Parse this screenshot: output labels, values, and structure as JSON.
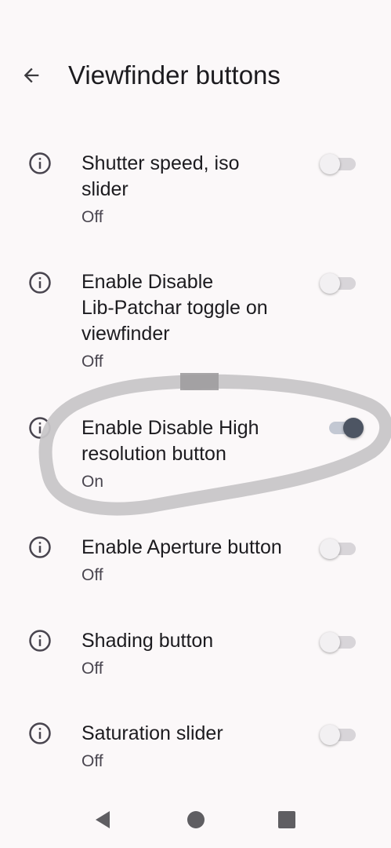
{
  "header": {
    "title": "Viewfinder buttons",
    "back_icon": "arrow-back-icon"
  },
  "settings": [
    {
      "title_lines": [
        "Shutter speed, iso",
        "slider"
      ],
      "status": "Off",
      "enabled": false
    },
    {
      "title_lines": [
        "Enable Disable",
        "Lib-Patchar toggle on",
        "viewfinder"
      ],
      "status": "Off",
      "enabled": false
    },
    {
      "title_lines": [
        "Enable Disable High",
        "resolution button"
      ],
      "status": "On",
      "enabled": true
    },
    {
      "title_lines": [
        "Enable Aperture button"
      ],
      "status": "Off",
      "enabled": false
    },
    {
      "title_lines": [
        "Shading button"
      ],
      "status": "Off",
      "enabled": false
    },
    {
      "title_lines": [
        "Saturation slider"
      ],
      "status": "Off",
      "enabled": false
    }
  ],
  "colors": {
    "background": "#fbf8f9",
    "switch_on_thumb": "#4d5563",
    "annotation_stroke": "#c8c6c8"
  },
  "icons": {
    "info": "info-icon",
    "nav_back": "nav-back-icon",
    "nav_home": "nav-home-icon",
    "nav_recents": "nav-recents-icon"
  }
}
